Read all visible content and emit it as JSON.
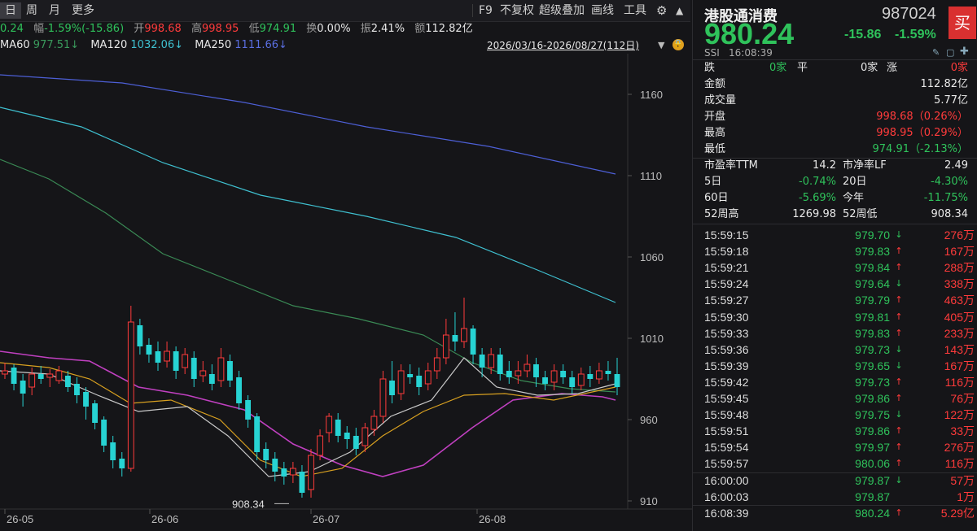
{
  "toolbar": {
    "tabs": [
      "日",
      "周",
      "月",
      "更多"
    ],
    "right_items": [
      "F9",
      "不复权",
      "超级叠加",
      "画线",
      "工具"
    ]
  },
  "info": {
    "price_tail": "0.24",
    "change_label": "幅",
    "change_text": "-1.59%(-15.86)",
    "open_label": "开",
    "open": "998.68",
    "high_label": "高",
    "high": "998.95",
    "low_label": "低",
    "low": "974.91",
    "turnover_label": "换",
    "turnover": "0.00%",
    "amplitude_label": "振",
    "amplitude": "2.41%",
    "amount_label": "额",
    "amount": "112.82亿"
  },
  "ma": {
    "ma60_label": "MA60",
    "ma60": "977.51↓",
    "ma120_label": "MA120",
    "ma120": "1032.06↓",
    "ma250_label": "MA250",
    "ma250": "1111.66↓",
    "range": "2026/03/16-2026/08/27(112日)"
  },
  "chart_data": {
    "type": "candlestick",
    "ylim": [
      905,
      1185
    ],
    "y_ticks": [
      "1160",
      "1110",
      "1060",
      "1010",
      "960",
      "910"
    ],
    "x_labels": [
      "26-05",
      "26-06",
      "26-07",
      "26-08"
    ],
    "low_annotation": "908.34",
    "candles": [
      [
        988,
        990,
        995,
        985
      ],
      [
        992,
        982,
        994,
        978
      ],
      [
        984,
        976,
        988,
        968
      ],
      [
        980,
        988,
        992,
        975
      ],
      [
        988,
        985,
        993,
        982
      ],
      [
        986,
        988,
        991,
        980
      ],
      [
        984,
        990,
        993,
        982
      ],
      [
        987,
        980,
        990,
        977
      ],
      [
        982,
        975,
        986,
        970
      ],
      [
        977,
        968,
        980,
        960
      ],
      [
        970,
        958,
        972,
        954
      ],
      [
        960,
        944,
        962,
        940
      ],
      [
        946,
        935,
        950,
        930
      ],
      [
        936,
        930,
        940,
        925
      ],
      [
        930,
        1020,
        1030,
        928
      ],
      [
        1018,
        1005,
        1022,
        1000
      ],
      [
        1006,
        1000,
        1010,
        995
      ],
      [
        1002,
        995,
        1008,
        990
      ],
      [
        996,
        1002,
        1008,
        992
      ],
      [
        1002,
        990,
        1005,
        985
      ],
      [
        992,
        1000,
        1004,
        988
      ],
      [
        998,
        985,
        1002,
        980
      ],
      [
        987,
        990,
        996,
        983
      ],
      [
        988,
        982,
        994,
        978
      ],
      [
        984,
        998,
        1004,
        980
      ],
      [
        996,
        984,
        1000,
        980
      ],
      [
        986,
        970,
        990,
        966
      ],
      [
        972,
        960,
        975,
        955
      ],
      [
        962,
        940,
        964,
        935
      ],
      [
        942,
        935,
        946,
        930
      ],
      [
        936,
        928,
        940,
        922
      ],
      [
        930,
        925,
        934,
        920
      ],
      [
        926,
        930,
        934,
        921
      ],
      [
        928,
        915,
        932,
        912
      ],
      [
        917,
        938,
        942,
        912
      ],
      [
        938,
        950,
        954,
        935
      ],
      [
        952,
        962,
        964,
        946
      ],
      [
        960,
        950,
        964,
        946
      ],
      [
        952,
        948,
        956,
        942
      ],
      [
        950,
        942,
        955,
        938
      ],
      [
        944,
        955,
        958,
        940
      ],
      [
        954,
        962,
        966,
        950
      ],
      [
        962,
        985,
        990,
        958
      ],
      [
        984,
        975,
        996,
        970
      ],
      [
        976,
        990,
        994,
        972
      ],
      [
        988,
        986,
        994,
        982
      ],
      [
        987,
        980,
        992,
        975
      ],
      [
        982,
        990,
        995,
        978
      ],
      [
        990,
        998,
        1004,
        985
      ],
      [
        998,
        1012,
        1022,
        994
      ],
      [
        1012,
        1008,
        1026,
        1002
      ],
      [
        1008,
        1016,
        1035,
        1004
      ],
      [
        1016,
        1000,
        1018,
        994
      ],
      [
        1000,
        992,
        1004,
        986
      ],
      [
        992,
        1000,
        1004,
        988
      ],
      [
        1000,
        988,
        1004,
        984
      ],
      [
        990,
        986,
        996,
        982
      ],
      [
        987,
        990,
        996,
        982
      ],
      [
        990,
        994,
        1000,
        986
      ],
      [
        994,
        986,
        998,
        980
      ],
      [
        986,
        982,
        990,
        978
      ],
      [
        983,
        990,
        994,
        978
      ],
      [
        990,
        986,
        994,
        982
      ],
      [
        986,
        980,
        990,
        976
      ],
      [
        981,
        988,
        992,
        978
      ],
      [
        988,
        985,
        993,
        980
      ],
      [
        985,
        990,
        995,
        982
      ],
      [
        990,
        988,
        996,
        984
      ],
      [
        988,
        980,
        998,
        975
      ]
    ],
    "series": [
      {
        "name": "MA250",
        "color": "#4d5fd6",
        "points": [
          [
            0,
            1172
          ],
          [
            150,
            1167
          ],
          [
            300,
            1155
          ],
          [
            450,
            1140
          ],
          [
            600,
            1128
          ],
          [
            756,
            1111
          ]
        ]
      },
      {
        "name": "MA120",
        "color": "#3fc0d0",
        "points": [
          [
            0,
            1152
          ],
          [
            100,
            1140
          ],
          [
            200,
            1118
          ],
          [
            320,
            1098
          ],
          [
            450,
            1085
          ],
          [
            560,
            1072
          ],
          [
            660,
            1052
          ],
          [
            756,
            1032
          ]
        ]
      },
      {
        "name": "MA60",
        "color": "#3a8a55",
        "points": [
          [
            0,
            1120
          ],
          [
            60,
            1108
          ],
          [
            130,
            1087
          ],
          [
            200,
            1062
          ],
          [
            280,
            1046
          ],
          [
            360,
            1030
          ],
          [
            440,
            1022
          ],
          [
            520,
            1012
          ],
          [
            580,
            995
          ],
          [
            640,
            984
          ],
          [
            700,
            979
          ],
          [
            756,
            977
          ]
        ]
      },
      {
        "name": "MA20",
        "color": "#c040c0",
        "points": [
          [
            0,
            1002
          ],
          [
            60,
            998
          ],
          [
            110,
            996
          ],
          [
            170,
            980
          ],
          [
            230,
            975
          ],
          [
            300,
            966
          ],
          [
            360,
            945
          ],
          [
            420,
            932
          ],
          [
            470,
            925
          ],
          [
            520,
            932
          ],
          [
            580,
            955
          ],
          [
            630,
            972
          ],
          [
            690,
            976
          ],
          [
            740,
            974
          ],
          [
            756,
            972
          ]
        ]
      },
      {
        "name": "MA10",
        "color": "#d8a020",
        "points": [
          [
            0,
            995
          ],
          [
            60,
            992
          ],
          [
            110,
            985
          ],
          [
            160,
            970
          ],
          [
            210,
            972
          ],
          [
            270,
            960
          ],
          [
            320,
            935
          ],
          [
            370,
            925
          ],
          [
            420,
            930
          ],
          [
            470,
            950
          ],
          [
            520,
            965
          ],
          [
            570,
            975
          ],
          [
            620,
            976
          ],
          [
            680,
            972
          ],
          [
            756,
            980
          ]
        ]
      },
      {
        "name": "MA5",
        "color": "#c9c9c9",
        "points": [
          [
            0,
            990
          ],
          [
            60,
            988
          ],
          [
            120,
            975
          ],
          [
            170,
            965
          ],
          [
            230,
            968
          ],
          [
            280,
            950
          ],
          [
            330,
            925
          ],
          [
            380,
            928
          ],
          [
            430,
            940
          ],
          [
            480,
            962
          ],
          [
            530,
            972
          ],
          [
            570,
            998
          ],
          [
            610,
            980
          ],
          [
            660,
            975
          ],
          [
            710,
            976
          ],
          [
            756,
            982
          ]
        ]
      }
    ]
  },
  "panel": {
    "name": "港股通消费",
    "code": "987024",
    "price": "980.24",
    "change": "-15.86",
    "change_pct": "-1.59%",
    "buy_label": "买",
    "index_code": "SSI",
    "time": "16:08:39",
    "breadth": {
      "down_label": "跌",
      "down_value": "0家",
      "flat_label": "平",
      "flat_value": "0家",
      "up_label": "涨",
      "up_value": "0家"
    },
    "stats": [
      {
        "label": "金额",
        "value": "112.82亿",
        "tone": "white"
      },
      {
        "label": "成交量",
        "value": "5.77亿",
        "tone": "white"
      },
      {
        "label": "开盘",
        "value": "998.68（0.26%）",
        "tone": "up"
      },
      {
        "label": "最高",
        "value": "998.95（0.29%）",
        "tone": "up"
      },
      {
        "label": "最低",
        "value": "974.91（-2.13%）",
        "tone": "down"
      }
    ],
    "ratios": [
      {
        "l1": "市盈率TTM",
        "v1": "14.2",
        "t1": "white",
        "l2": "市净率LF",
        "v2": "2.49",
        "t2": "white"
      },
      {
        "l1": "5日",
        "v1": "-0.74%",
        "t1": "down",
        "l2": "20日",
        "v2": "-4.30%",
        "t2": "down"
      },
      {
        "l1": "60日",
        "v1": "-5.69%",
        "t1": "down",
        "l2": "今年",
        "v2": "-11.75%",
        "t2": "down"
      },
      {
        "l1": "52周高",
        "v1": "1269.98",
        "t1": "white",
        "l2": "52周低",
        "v2": "908.34",
        "t2": "white"
      }
    ],
    "ticks": [
      {
        "time": "15:59:15",
        "price": "979.70",
        "dir": "down",
        "vol": "276万"
      },
      {
        "time": "15:59:18",
        "price": "979.83",
        "dir": "up",
        "vol": "167万"
      },
      {
        "time": "15:59:21",
        "price": "979.84",
        "dir": "up",
        "vol": "288万"
      },
      {
        "time": "15:59:24",
        "price": "979.64",
        "dir": "down",
        "vol": "338万"
      },
      {
        "time": "15:59:27",
        "price": "979.79",
        "dir": "up",
        "vol": "463万"
      },
      {
        "time": "15:59:30",
        "price": "979.81",
        "dir": "up",
        "vol": "405万"
      },
      {
        "time": "15:59:33",
        "price": "979.83",
        "dir": "up",
        "vol": "233万"
      },
      {
        "time": "15:59:36",
        "price": "979.73",
        "dir": "down",
        "vol": "143万"
      },
      {
        "time": "15:59:39",
        "price": "979.65",
        "dir": "down",
        "vol": "167万"
      },
      {
        "time": "15:59:42",
        "price": "979.73",
        "dir": "up",
        "vol": "116万"
      },
      {
        "time": "15:59:45",
        "price": "979.86",
        "dir": "up",
        "vol": "76万"
      },
      {
        "time": "15:59:48",
        "price": "979.75",
        "dir": "down",
        "vol": "122万"
      },
      {
        "time": "15:59:51",
        "price": "979.86",
        "dir": "up",
        "vol": "33万"
      },
      {
        "time": "15:59:54",
        "price": "979.97",
        "dir": "up",
        "vol": "276万"
      },
      {
        "time": "15:59:57",
        "price": "980.06",
        "dir": "up",
        "vol": "116万"
      },
      {
        "time": "16:00:00",
        "price": "979.87",
        "dir": "down",
        "vol": "57万"
      },
      {
        "time": "16:00:03",
        "price": "979.87",
        "dir": "none",
        "vol": "1万"
      },
      {
        "time": "16:08:39",
        "price": "980.24",
        "dir": "up",
        "vol": "5.29亿"
      }
    ]
  }
}
